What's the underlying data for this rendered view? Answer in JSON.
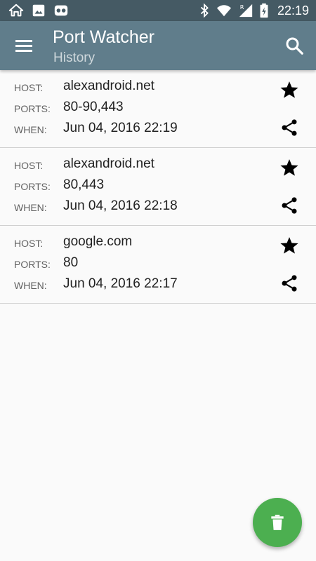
{
  "status_bar": {
    "time": "22:19",
    "left_icons": [
      "home-outline-icon",
      "image-icon",
      "app-notification-icon"
    ],
    "right_icons": [
      "bluetooth-icon",
      "wifi-icon",
      "signal-roaming-icon",
      "battery-icon"
    ]
  },
  "toolbar": {
    "title": "Port Watcher",
    "subtitle": "History",
    "background": "#607d8b",
    "status_background": "#455a64"
  },
  "labels": {
    "host": "HOST:",
    "ports": "PORTS:",
    "when": "WHEN:"
  },
  "history": [
    {
      "host": "alexandroid.net",
      "ports": "80-90,443",
      "when": "Jun 04, 2016  22:19",
      "starred": true
    },
    {
      "host": "alexandroid.net",
      "ports": "80,443",
      "when": "Jun 04, 2016  22:18",
      "starred": true
    },
    {
      "host": "google.com",
      "ports": "80",
      "when": "Jun 04, 2016  22:17",
      "starred": true
    }
  ],
  "fab": {
    "icon": "delete-icon",
    "color": "#4caf50"
  }
}
